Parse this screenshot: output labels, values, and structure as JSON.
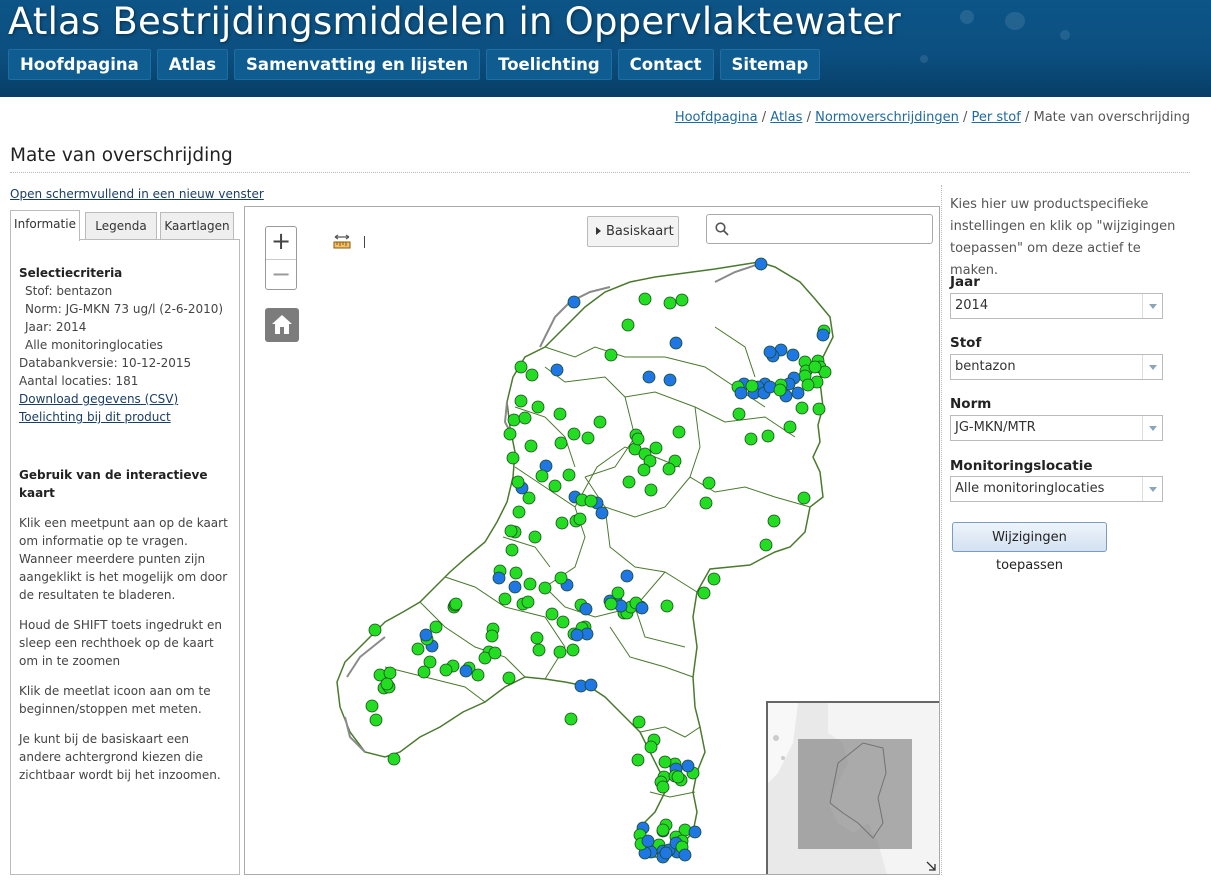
{
  "header": {
    "title": "Atlas Bestrijdingsmiddelen in Oppervlaktewater",
    "nav": [
      "Hoofdpagina",
      "Atlas",
      "Samenvatting en lijsten",
      "Toelichting",
      "Contact",
      "Sitemap"
    ]
  },
  "breadcrumb": {
    "items": [
      "Hoofdpagina",
      "Atlas",
      "Normoverschrijdingen",
      "Per stof"
    ],
    "current": "Mate van overschrijding",
    "separator": "/"
  },
  "page": {
    "title": "Mate van overschrijding",
    "fullscreen_link": "Open schermvullend in een nieuw venster"
  },
  "tabs": [
    "Informatie",
    "Legenda",
    "Kaartlagen"
  ],
  "info": {
    "criteria_heading": "Selectiecriteria",
    "criteria": [
      "Stof: bentazon",
      "Norm: JG-MKN 73 ug/l (2-6-2010)",
      "Jaar: 2014",
      "Alle monitoringlocaties"
    ],
    "db_version": "Databankversie: 10-12-2015",
    "locations": "Aantal locaties: 181",
    "download_link": "Download gegevens (CSV)",
    "explain_link": "Toelichting bij dit product",
    "usage_heading": "Gebruik van de interactieve kaart",
    "usage": [
      "Klik een meetpunt aan op de kaart om informatie op te vragen. Wanneer meerdere punten zijn aangeklikt is het mogelijk om door de resultaten te bladeren.",
      "Houd de SHIFT toets ingedrukt en sleep een rechthoek op de kaart om in te zoomen",
      "Klik de meetlat icoon aan om te beginnen/stoppen met meten.",
      "Je kunt bij de basiskaart een andere achtergrond kiezen die zichtbaar wordt bij het inzoomen."
    ]
  },
  "map": {
    "zoom_in": "+",
    "zoom_out": "−",
    "basemap_label": "Basiskaart",
    "search_placeholder": "",
    "colors": {
      "green": "#22dd22",
      "blue": "#1f77e6",
      "border": "#4a7a2e",
      "coast": "#8a8a8a"
    }
  },
  "settings": {
    "intro": "Kies hier uw productspecifieke instellingen en klik op \"wijzigingen toepassen\" om deze actief te maken.",
    "fields": [
      {
        "label": "Jaar",
        "value": "2014"
      },
      {
        "label": "Stof",
        "value": "bentazon"
      },
      {
        "label": "Norm",
        "value": "JG-MKN/MTR"
      },
      {
        "label": "Monitoringslocatie",
        "value": "Alle monitoringlocaties"
      }
    ],
    "apply_button": "Wijzigingen toepassen"
  }
}
